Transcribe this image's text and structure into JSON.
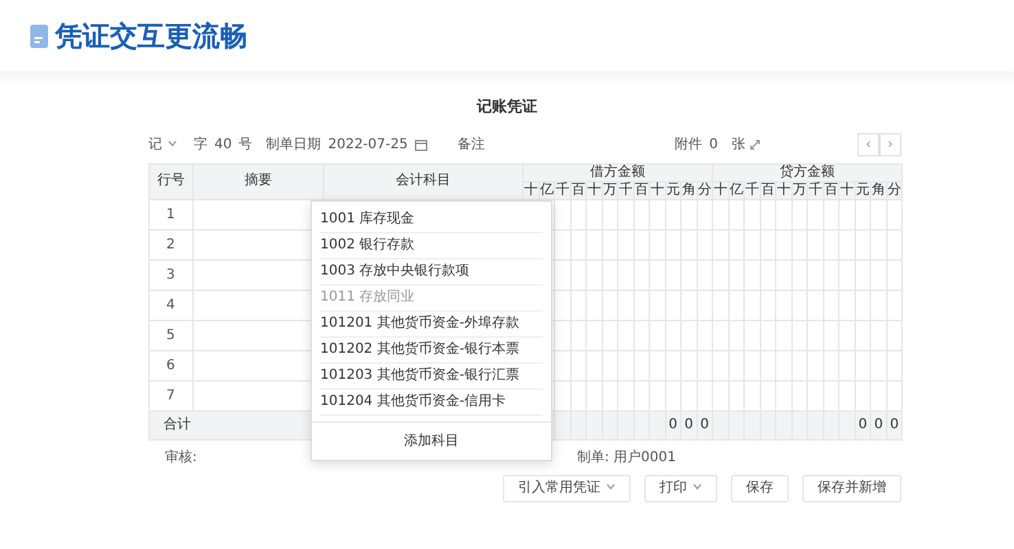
{
  "banner": {
    "title": "凭证交互更流畅"
  },
  "voucher": {
    "title": "记账凭证",
    "type": "记",
    "word": "字",
    "number": "40",
    "number_suffix": "号",
    "date_label": "制单日期",
    "date": "2022-07-25",
    "note_label": "备注",
    "attachment_label": "附件",
    "attachment_count": "0",
    "attachment_unit": "张",
    "pager": [
      "‹",
      "›"
    ]
  },
  "table": {
    "columns": [
      "行号",
      "摘要",
      "会计科目"
    ],
    "debit_title": "借方金额",
    "credit_title": "贷方金额",
    "debit_digits": [
      "十",
      "亿",
      "千",
      "百",
      "十",
      "万",
      "千",
      "百",
      "十",
      "元",
      "角",
      "分"
    ],
    "credit_digits": [
      "十",
      "亿",
      "千",
      "百",
      "十",
      "万",
      "千",
      "百",
      "十",
      "元",
      "角",
      "分"
    ],
    "rows": [
      {
        "number": "1"
      },
      {
        "number": "2"
      },
      {
        "number": "3"
      },
      {
        "number": "4"
      },
      {
        "number": "5"
      },
      {
        "number": "6"
      },
      {
        "number": "7"
      }
    ],
    "total": {
      "label": "合计",
      "debit": [
        "0",
        "0",
        "0"
      ],
      "credit": [
        "0",
        "0",
        "0"
      ]
    }
  },
  "dropdown": {
    "items": [
      {
        "text": "1001 库存现金",
        "selected": false
      },
      {
        "text": "1002 银行存款",
        "selected": false
      },
      {
        "text": "1003 存放中央银行款项",
        "selected": false
      },
      {
        "text": "1011 存放同业",
        "selected": true
      },
      {
        "text": "101201 其他货币资金-外埠存款",
        "selected": false
      },
      {
        "text": "101202 其他货币资金-银行本票",
        "selected": false
      },
      {
        "text": "101203 其他货币资金-银行汇票",
        "selected": false
      },
      {
        "text": "101204 其他货币资金-信用卡",
        "selected": false
      }
    ],
    "footer": "添加科目"
  },
  "footer": {
    "reviewer": "审核:",
    "maker": "制单: 用户0001"
  },
  "buttons": [
    {
      "label": "引入常用凭证",
      "dropdown": true
    },
    {
      "label": "打印",
      "dropdown": true
    },
    {
      "label": "保存",
      "dropdown": false
    },
    {
      "label": "保存并新增",
      "dropdown": false
    }
  ]
}
